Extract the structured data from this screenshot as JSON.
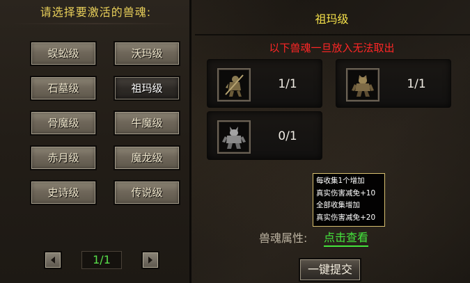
{
  "left_panel": {
    "title": "请选择要激活的兽魂:",
    "levels": [
      {
        "label": "蜈蚣级"
      },
      {
        "label": "沃玛级"
      },
      {
        "label": "石墓级"
      },
      {
        "label": "祖玛级"
      },
      {
        "label": "骨魔级"
      },
      {
        "label": "牛魔级"
      },
      {
        "label": "赤月级"
      },
      {
        "label": "魔龙级"
      },
      {
        "label": "史诗级"
      },
      {
        "label": "传说级"
      }
    ],
    "selected_level": "祖玛级",
    "pager": {
      "text": "1/1"
    }
  },
  "right_panel": {
    "title": "祖玛级",
    "warning": "以下兽魂一旦放入无法取出",
    "slots": [
      {
        "icon": "zuma-archer-icon",
        "count": "1/1"
      },
      {
        "icon": "zuma-guardian-icon",
        "count": "1/1"
      },
      {
        "icon": "zuma-statue-icon",
        "count": "0/1"
      }
    ],
    "tooltip": {
      "lines": [
        "每收集1个增加",
        "真实伤害减免+10",
        "全部收集增加",
        "真实伤害减免+20"
      ]
    },
    "attr_label": "兽魂属性:",
    "attr_link": "点击查看",
    "submit": "一键提交"
  },
  "colors": {
    "title_gold": "#e8cf5a",
    "warning_red": "#ff2626",
    "link_green": "#45e63d"
  }
}
